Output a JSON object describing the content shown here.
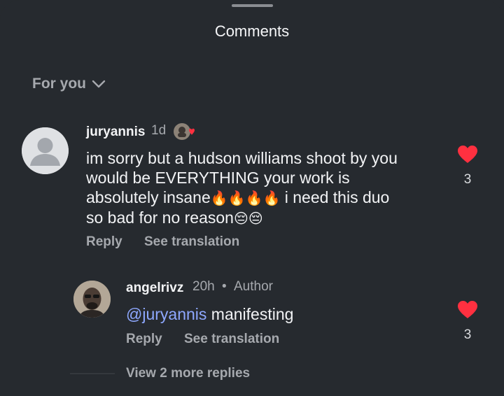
{
  "sheet": {
    "title": "Comments"
  },
  "filter": {
    "label": "For you"
  },
  "comments": [
    {
      "username": "juryannis",
      "age": "1d",
      "text_line1": "im sorry but a hudson williams shoot by you",
      "text_line2": "would be EVERYTHING your work is",
      "text_line3_a": "absolutely insane",
      "text_line3_emoji": "🔥🔥🔥🔥",
      "text_line3_b": " i need this duo",
      "text_line4_a": "so bad for no reason",
      "text_line4_emoji": "😔😔",
      "reply_label": "Reply",
      "translate_label": "See translation",
      "likes": "3",
      "like_icon": "heart-filled-icon",
      "avatar": "default-avatar-icon"
    },
    {
      "username": "angelrivz",
      "age": "20h",
      "separator": "•",
      "badge": "Author",
      "mention": "@juryannis",
      "text": " manifesting",
      "reply_label": "Reply",
      "translate_label": "See translation",
      "likes": "3",
      "like_icon": "heart-filled-icon",
      "avatar": "profile-photo"
    }
  ],
  "view_more": "View 2 more replies",
  "colors": {
    "background": "#262a2f",
    "muted_text": "#a6a9ae",
    "heart": "#ff3040",
    "mention": "#8ea8ff"
  }
}
